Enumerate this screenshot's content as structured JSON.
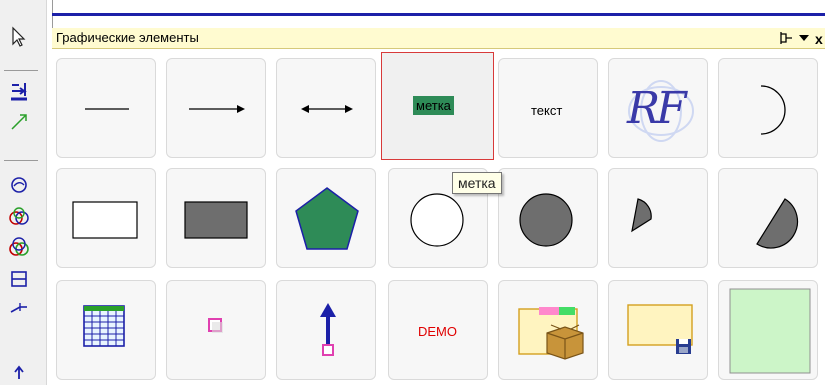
{
  "panel": {
    "title": "Графические элементы",
    "pin_icon": "pin-icon",
    "dropdown_icon": "dropdown-arrow-icon",
    "close_label": "x"
  },
  "toolbar_icons": [
    "pointer-icon",
    "align-bottom-icon",
    "arrow-line-icon",
    "ellipse-tool-icon",
    "intersect-icon",
    "union-icon",
    "split-rect-icon",
    "link-line-icon",
    "up-arrow-icon"
  ],
  "tiles": {
    "label_tile_text": "метка",
    "text_tile_text": "текст",
    "logo_text": "RF",
    "demo_text": "DEMO"
  },
  "tooltip": "метка",
  "colors": {
    "label_bg": "#2e8b57",
    "pentagon_fill": "#2e8b57",
    "gray_shape": "#6e6e6e",
    "demo_red": "#e00000",
    "selection_border": "#d83a3a",
    "green_panel": "#ccf5c8",
    "title_bar": "#fffbd0"
  }
}
